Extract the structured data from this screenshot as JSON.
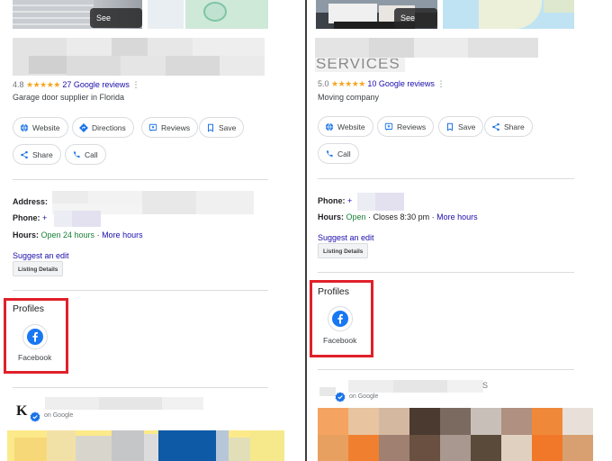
{
  "left": {
    "see_photos": "See photos",
    "rating": "4.8",
    "stars": "★★★★★",
    "reviews": "27 Google reviews",
    "category": "Garage door supplier in Florida",
    "actions": [
      "Website",
      "Directions",
      "Reviews",
      "Save",
      "Share",
      "Call"
    ],
    "address_label": "Address:",
    "phone_label": "Phone:",
    "phone_prefix": "+",
    "hours_label": "Hours:",
    "hours_status": "Open 24 hours",
    "hours_sep": " · ",
    "more_hours": "More hours",
    "suggest_edit": "Suggest an edit",
    "listing_details": "Listing Details",
    "profiles_title": "Profiles",
    "facebook": "Facebook",
    "on_google": "on Google",
    "logo_letter": "K"
  },
  "right": {
    "see_photos": "See photos",
    "name_partial": "SERVICES",
    "rating": "5.0",
    "stars": "★★★★★",
    "reviews": "10 Google reviews",
    "category": "Moving company",
    "actions": [
      "Website",
      "Reviews",
      "Save",
      "Share",
      "Call"
    ],
    "phone_label": "Phone:",
    "phone_prefix": "+",
    "hours_label": "Hours:",
    "hours_status": "Open",
    "hours_close": " · Closes 8:30 pm · ",
    "more_hours": "More hours",
    "suggest_edit": "Suggest an edit",
    "listing_details": "Listing Details",
    "profiles_title": "Profiles",
    "facebook": "Facebook",
    "on_google": "on Google",
    "post_title_tail": "S"
  },
  "colors": {
    "link": "#1a0dab",
    "open_green": "#188038",
    "star": "#f5a623",
    "highlight_box": "#e0202a",
    "facebook": "#1877f2"
  },
  "icons": {
    "website": "globe-icon",
    "directions": "directions-icon",
    "reviews": "review-icon",
    "save": "bookmark-icon",
    "share": "share-icon",
    "call": "phone-icon",
    "facebook": "facebook-icon"
  }
}
